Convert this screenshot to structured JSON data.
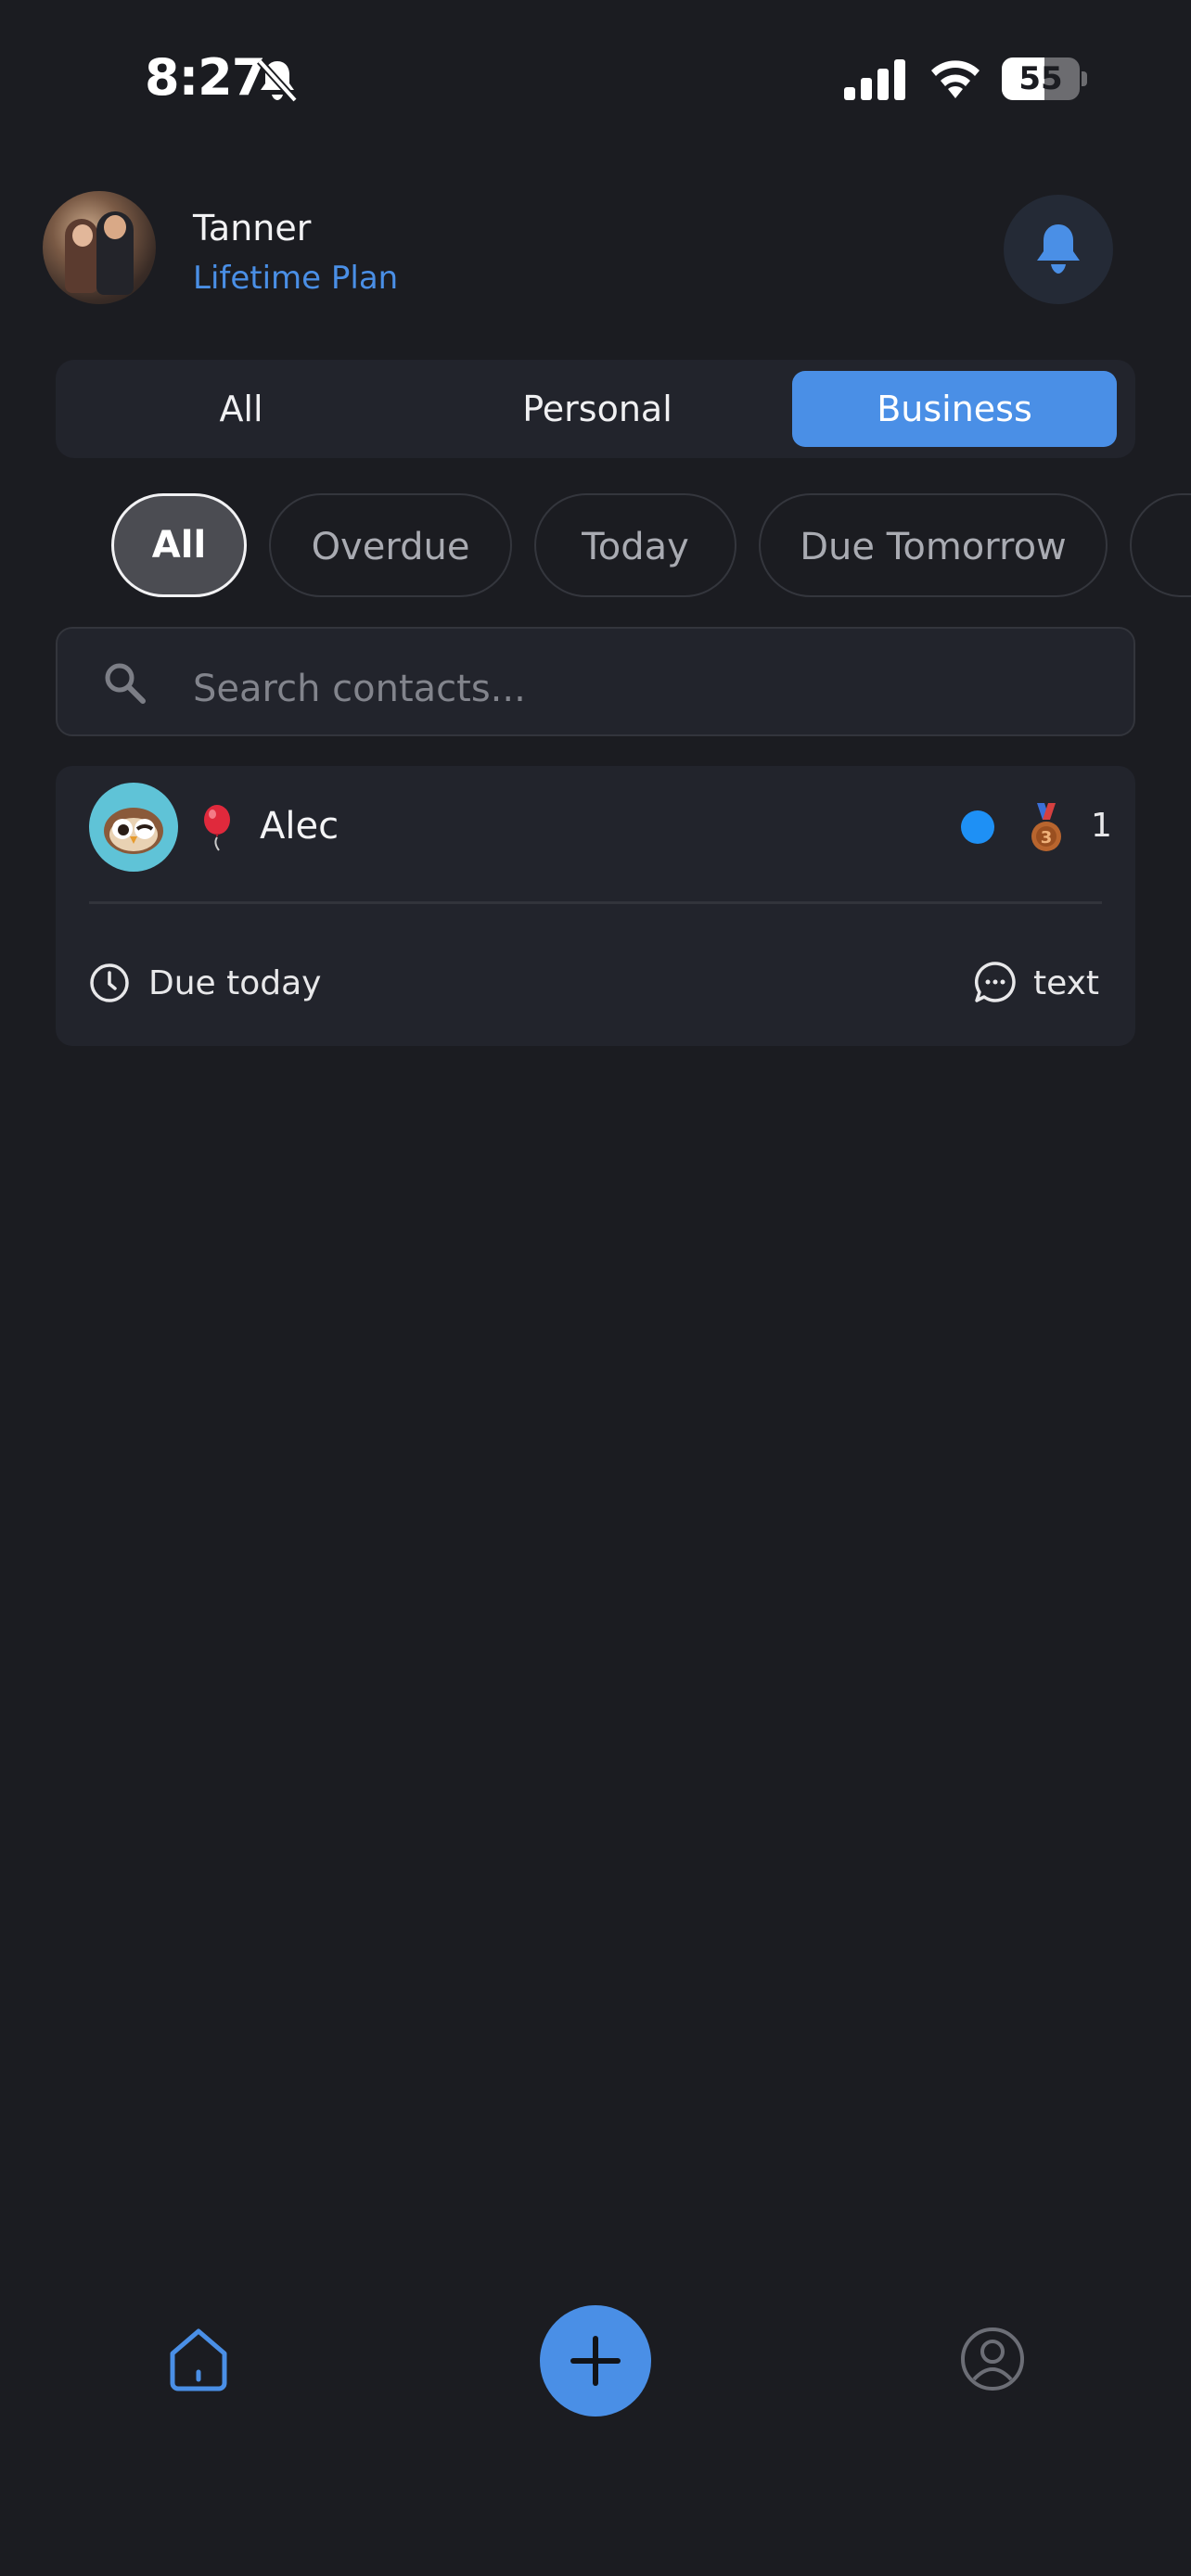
{
  "status_bar": {
    "time": "8:27",
    "battery": "55",
    "battery_level": 0.55
  },
  "header": {
    "user_name": "Tanner",
    "plan": "Lifetime Plan"
  },
  "segments": [
    {
      "label": "All",
      "active": false
    },
    {
      "label": "Personal",
      "active": false
    },
    {
      "label": "Business",
      "active": true
    }
  ],
  "filters": [
    {
      "label": "All",
      "active": true
    },
    {
      "label": "Overdue",
      "active": false
    },
    {
      "label": "Today",
      "active": false
    },
    {
      "label": "Due Tomorrow",
      "active": false
    }
  ],
  "search": {
    "placeholder": "Search contacts..."
  },
  "contacts": [
    {
      "name": "Alec",
      "count": "1",
      "due": "Due today",
      "method": "text",
      "status_color": "#1e90f5"
    }
  ],
  "colors": {
    "accent": "#4a8fe6",
    "background": "#1b1c21",
    "card": "#22242c"
  },
  "nav": {
    "items": [
      "home-icon",
      "add-icon",
      "profile-icon"
    ]
  }
}
